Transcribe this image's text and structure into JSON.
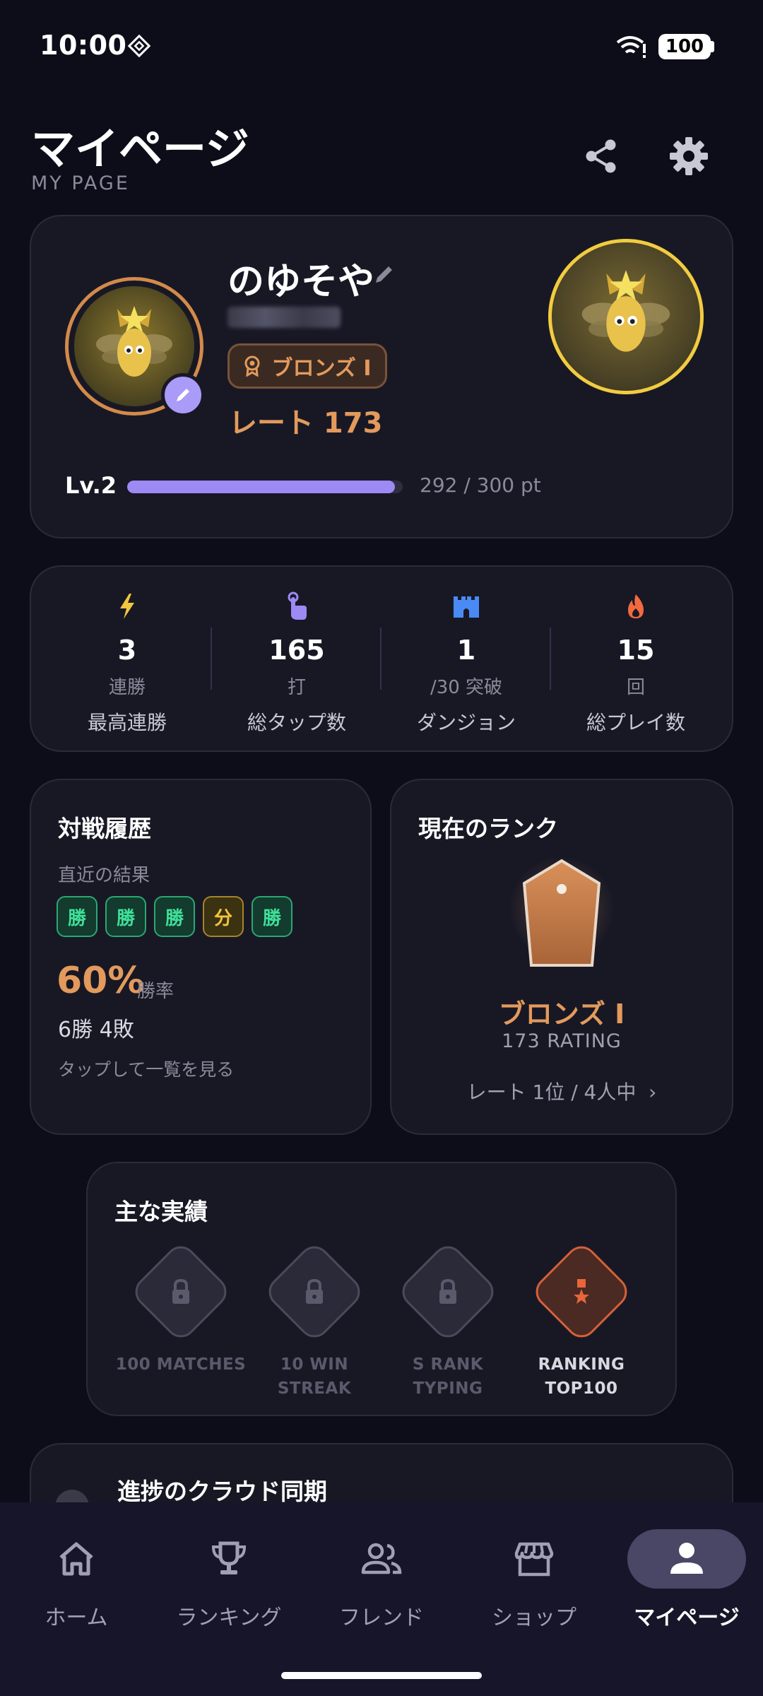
{
  "status": {
    "time": "10:00",
    "battery": "100"
  },
  "header": {
    "title": "マイページ",
    "subtitle": "MY PAGE"
  },
  "profile": {
    "name": "のゆそや",
    "rank_badge": "ブロンズ I",
    "rate": "レート 173",
    "level": "Lv.2",
    "level_progress": 0.973,
    "level_points": "292 / 300 pt"
  },
  "stats": [
    {
      "icon": "lightning-icon",
      "value": "3",
      "unit": "連勝",
      "label": "最高連勝",
      "color": "#f2c53f"
    },
    {
      "icon": "tap-icon",
      "value": "165",
      "unit": "打",
      "label": "総タップ数",
      "color": "#9d8af5"
    },
    {
      "icon": "castle-icon",
      "value": "1",
      "unit": "/30 突破",
      "label": "ダンジョン",
      "color": "#4a8af5"
    },
    {
      "icon": "flame-icon",
      "value": "15",
      "unit": "回",
      "label": "総プレイ数",
      "color": "#f26a3f"
    }
  ],
  "history": {
    "title": "対戦履歴",
    "recent_label": "直近の結果",
    "results": [
      "勝",
      "勝",
      "勝",
      "分",
      "勝"
    ],
    "winrate": "60%",
    "winrate_label": "勝率",
    "record": "6勝 4敗",
    "link": "タップして一覧を見る"
  },
  "current_rank": {
    "title": "現在のランク",
    "name": "ブロンズ I",
    "rating": "173 RATING",
    "position": "レート 1位 / 4人中"
  },
  "achievements": {
    "title": "主な実績",
    "items": [
      {
        "line1": "100 MATCHES",
        "line2": "",
        "locked": true
      },
      {
        "line1": "10 WIN",
        "line2": "STREAK",
        "locked": true
      },
      {
        "line1": "S RANK",
        "line2": "TYPING",
        "locked": true
      },
      {
        "line1": "RANKING",
        "line2": "TOP100",
        "locked": false
      }
    ]
  },
  "sync": {
    "title": "進捗のクラウド同期"
  },
  "nav": [
    {
      "label": "ホーム",
      "icon": "home-icon"
    },
    {
      "label": "ランキング",
      "icon": "trophy-icon"
    },
    {
      "label": "フレンド",
      "icon": "friends-icon"
    },
    {
      "label": "ショップ",
      "icon": "shop-icon"
    },
    {
      "label": "マイページ",
      "icon": "person-icon",
      "active": true
    }
  ],
  "colors": {
    "accent": "#9d8af5",
    "bronze": "#e39a5c",
    "win": "#3fe09a",
    "draw": "#f2c53f"
  }
}
